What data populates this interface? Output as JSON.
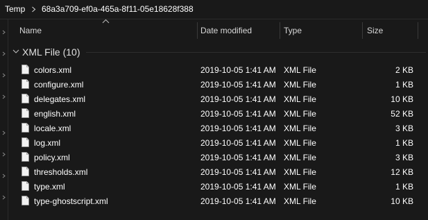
{
  "breadcrumb": {
    "parent": "Temp",
    "current": "68a3a709-ef0a-465a-8f11-05e18628f388"
  },
  "columns": {
    "name": "Name",
    "date": "Date modified",
    "type": "Type",
    "size": "Size"
  },
  "group": {
    "label": "XML File (10)"
  },
  "files": [
    {
      "name": "colors.xml",
      "date": "2019-10-05 1:41 AM",
      "type": "XML File",
      "size": "2 KB"
    },
    {
      "name": "configure.xml",
      "date": "2019-10-05 1:41 AM",
      "type": "XML File",
      "size": "1 KB"
    },
    {
      "name": "delegates.xml",
      "date": "2019-10-05 1:41 AM",
      "type": "XML File",
      "size": "10 KB"
    },
    {
      "name": "english.xml",
      "date": "2019-10-05 1:41 AM",
      "type": "XML File",
      "size": "52 KB"
    },
    {
      "name": "locale.xml",
      "date": "2019-10-05 1:41 AM",
      "type": "XML File",
      "size": "3 KB"
    },
    {
      "name": "log.xml",
      "date": "2019-10-05 1:41 AM",
      "type": "XML File",
      "size": "1 KB"
    },
    {
      "name": "policy.xml",
      "date": "2019-10-05 1:41 AM",
      "type": "XML File",
      "size": "3 KB"
    },
    {
      "name": "thresholds.xml",
      "date": "2019-10-05 1:41 AM",
      "type": "XML File",
      "size": "12 KB"
    },
    {
      "name": "type.xml",
      "date": "2019-10-05 1:41 AM",
      "type": "XML File",
      "size": "1 KB"
    },
    {
      "name": "type-ghostscript.xml",
      "date": "2019-10-05 1:41 AM",
      "type": "XML File",
      "size": "10 KB"
    }
  ],
  "icons": {
    "breadcrumb_separator": "chevron-right-icon",
    "sort": "sort-ascending-icon",
    "group_toggle": "chevron-down-icon",
    "file": "xml-file-icon"
  },
  "colors": {
    "background": "#191919",
    "text": "#ffffff",
    "header_text": "#d8d8d8",
    "divider": "#3a3a3a"
  }
}
